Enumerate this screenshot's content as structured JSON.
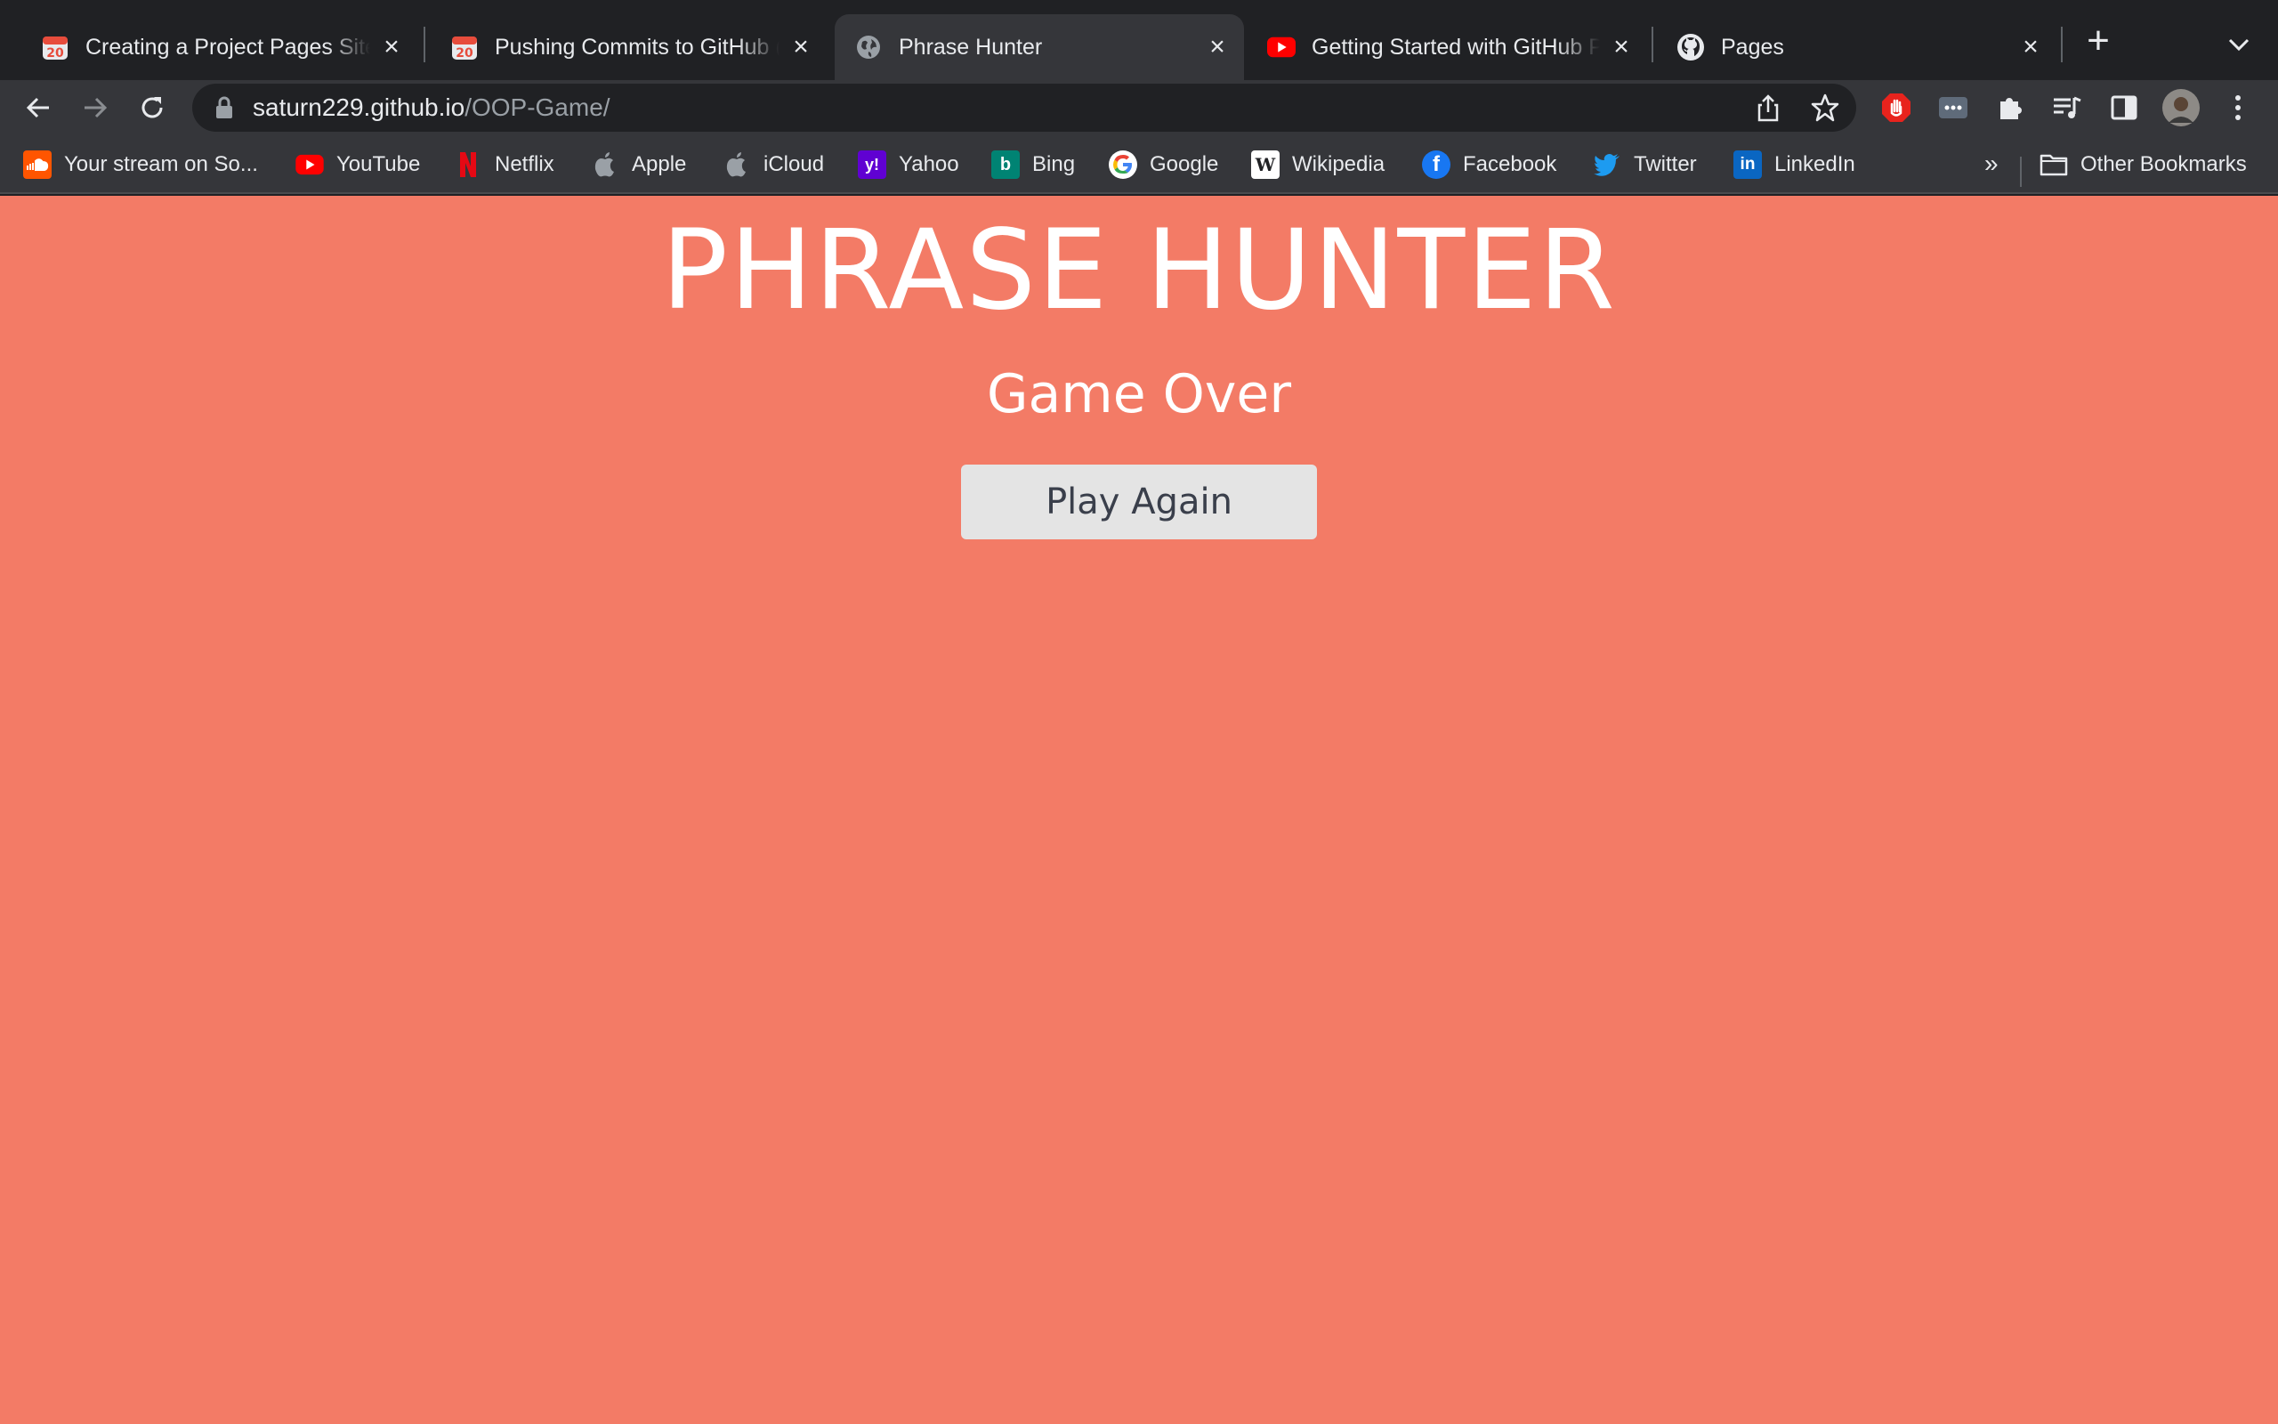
{
  "browser": {
    "tabs": [
      {
        "title": "Creating a Project Pages Site",
        "favicon": "calendar-20-icon",
        "active": false
      },
      {
        "title": "Pushing Commits to GitHub (",
        "favicon": "calendar-20-icon",
        "active": false
      },
      {
        "title": "Phrase Hunter",
        "favicon": "globe-icon",
        "active": true
      },
      {
        "title": "Getting Started with GitHub P",
        "favicon": "youtube-icon",
        "active": false
      },
      {
        "title": "Pages",
        "favicon": "github-icon",
        "active": false
      }
    ],
    "address": {
      "host": "saturn229.github.io",
      "path": "/OOP-Game/"
    },
    "bookmarks": [
      {
        "label": "Your stream on So...",
        "icon": "soundcloud-icon",
        "color": "#ff5500"
      },
      {
        "label": "YouTube",
        "icon": "youtube-icon",
        "color": "#ff0000"
      },
      {
        "label": "Netflix",
        "icon": "netflix-icon",
        "color": "#e50914"
      },
      {
        "label": "Apple",
        "icon": "apple-icon",
        "color": "#9aa0a6"
      },
      {
        "label": "iCloud",
        "icon": "apple-icon",
        "color": "#9aa0a6"
      },
      {
        "label": "Yahoo",
        "icon": "yahoo-icon",
        "color": "#6001d2"
      },
      {
        "label": "Bing",
        "icon": "bing-icon",
        "color": "#008373"
      },
      {
        "label": "Google",
        "icon": "google-icon",
        "color": "#ffffff"
      },
      {
        "label": "Wikipedia",
        "icon": "wikipedia-icon",
        "color": "#ffffff"
      },
      {
        "label": "Facebook",
        "icon": "facebook-icon",
        "color": "#1877f2"
      },
      {
        "label": "Twitter",
        "icon": "twitter-icon",
        "color": "#1d9bf0"
      },
      {
        "label": "LinkedIn",
        "icon": "linkedin-icon",
        "color": "#0a66c2"
      }
    ],
    "overflow_label": "»",
    "other_bookmarks": "Other Bookmarks"
  },
  "game": {
    "title": "PHRASE HUNTER",
    "message": "Game Over",
    "button_label": "Play Again",
    "background_color": "#f37b66"
  }
}
